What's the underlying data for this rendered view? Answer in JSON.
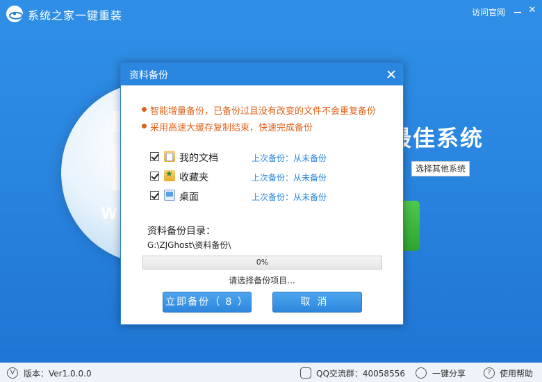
{
  "app": {
    "title": "系统之家一键重装",
    "official_link": "访问官网",
    "headline": "最佳系统",
    "select_other_button": "选择其他系统",
    "circle_letter": "W"
  },
  "statusbar": {
    "version_label": "版本：Ver1.0.0.0",
    "qq_group": "QQ交流群：40058556",
    "share": "一键分享",
    "help": "使用帮助",
    "version_icon_glyph": "V",
    "help_icon_glyph": "?"
  },
  "dialog": {
    "title": "资料备份",
    "tips": [
      "智能增量备份，已备份过且没有改变的文件不会重复备份",
      "采用高速大缓存复制结束，快速完成备份"
    ],
    "items": [
      {
        "name": "我的文档",
        "status": "上次备份：从未备份",
        "checked": true,
        "icon": "documents-folder-icon"
      },
      {
        "name": "收藏夹",
        "status": "上次备份：从未备份",
        "checked": true,
        "icon": "favorites-folder-icon"
      },
      {
        "name": "桌面",
        "status": "上次备份：从未备份",
        "checked": true,
        "icon": "desktop-icon"
      }
    ],
    "dir_label": "资料备份目录：",
    "dir_path": "G:\\ZJGhost\\资料备份\\",
    "progress": {
      "percent": 0,
      "label": "0%"
    },
    "hint": "请选择备份项目...",
    "backup_button": "立即备份（ 8 ）",
    "cancel_button": "取消"
  },
  "colors": {
    "accent": "#2b86e0",
    "tip": "#e0621a",
    "link": "#2a86d8"
  }
}
